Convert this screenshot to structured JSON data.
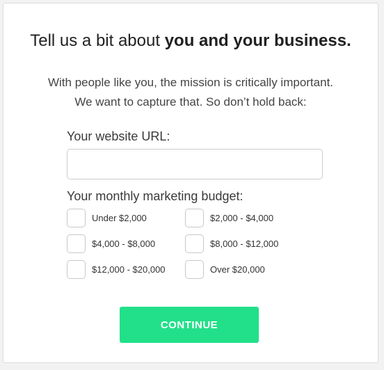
{
  "heading": {
    "prefix": "Tell us a bit about ",
    "emphasis": "you and your business."
  },
  "subtitle": {
    "line1": "With people like you, the mission is critically important.",
    "line2": "We want to capture that. So don’t hold back:"
  },
  "website": {
    "label": "Your website URL:",
    "value": "",
    "placeholder": ""
  },
  "budget": {
    "label": "Your monthly marketing budget:",
    "options": [
      {
        "label": "Under $2,000",
        "checked": false
      },
      {
        "label": "$2,000 - $4,000",
        "checked": false
      },
      {
        "label": "$4,000 - $8,000",
        "checked": false
      },
      {
        "label": "$8,000 - $12,000",
        "checked": false
      },
      {
        "label": "$12,000 - $20,000",
        "checked": false
      },
      {
        "label": "Over $20,000",
        "checked": false
      }
    ]
  },
  "continue_label": "CONTINUE",
  "colors": {
    "accent": "#22e08a",
    "text": "#222222",
    "border": "#cccccc"
  }
}
